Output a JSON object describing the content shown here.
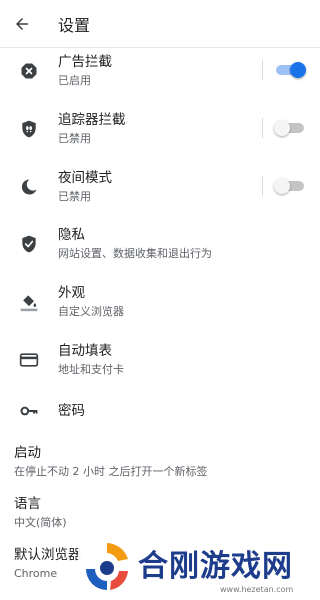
{
  "header": {
    "title": "设置",
    "back_icon": "arrow-back-icon"
  },
  "settings": [
    {
      "icon": "ad-block-icon",
      "title": "广告拦截",
      "subtitle": "已启用",
      "toggle": true
    },
    {
      "icon": "tracker-block-icon",
      "title": "追踪器拦截",
      "subtitle": "已禁用",
      "toggle": false
    },
    {
      "icon": "moon-icon",
      "title": "夜间模式",
      "subtitle": "已禁用",
      "toggle": false
    },
    {
      "icon": "shield-check-icon",
      "title": "隐私",
      "subtitle": "网站设置、数据收集和退出行为"
    },
    {
      "icon": "paint-bucket-icon",
      "title": "外观",
      "subtitle": "自定义浏览器"
    },
    {
      "icon": "credit-card-icon",
      "title": "自动填表",
      "subtitle": "地址和支付卡"
    },
    {
      "icon": "key-icon",
      "title": "密码"
    }
  ],
  "plain_settings": [
    {
      "title": "启动",
      "subtitle": "在停止不动 2 小时 之后打开一个新标签"
    },
    {
      "title": "语言",
      "subtitle": "中文(简体)"
    },
    {
      "title": "默认浏览器",
      "subtitle": "Chrome"
    }
  ],
  "watermark": {
    "brand": "合刚游戏网",
    "url": "www.hezetan.com"
  },
  "colors": {
    "accent": "#1a73e8",
    "accent_track": "#9cc1f4",
    "icon": "#3c4043"
  }
}
